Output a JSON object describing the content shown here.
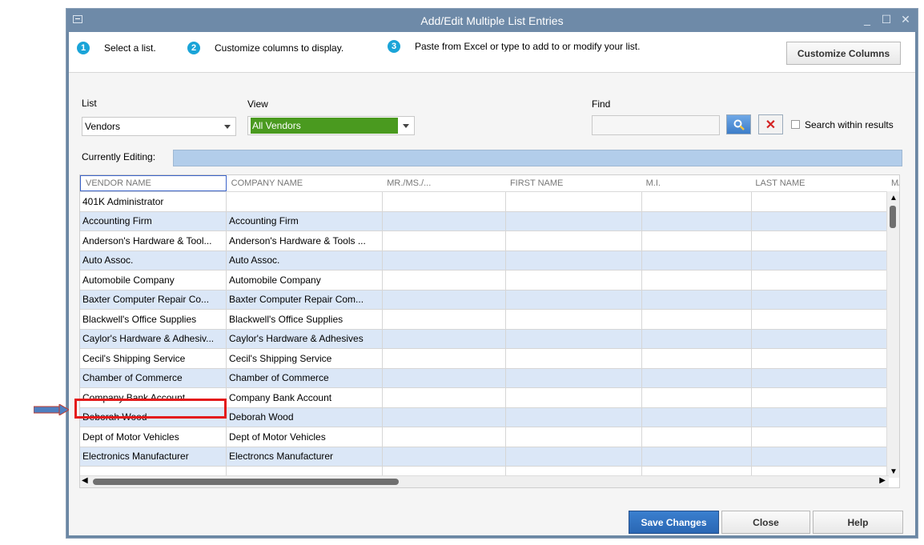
{
  "window": {
    "title": "Add/Edit Multiple List Entries"
  },
  "steps": [
    {
      "num": "1",
      "text": "Select a list."
    },
    {
      "num": "2",
      "text": "Customize columns to display."
    },
    {
      "num": "3",
      "text": "Paste from Excel or type to add to or modify your list."
    }
  ],
  "customize_button": "Customize Columns",
  "list": {
    "label": "List",
    "value": "Vendors"
  },
  "view": {
    "label": "View",
    "value": "All Vendors"
  },
  "find": {
    "label": "Find",
    "value": "",
    "search_within": "Search within results"
  },
  "currently_editing": {
    "label": "Currently Editing:",
    "value": ""
  },
  "columns": [
    "VENDOR NAME",
    "COMPANY NAME",
    "MR./MS./...",
    "FIRST NAME",
    "M.I.",
    "LAST NAME",
    "M/"
  ],
  "rows": [
    [
      "401K Administrator",
      ""
    ],
    [
      "Accounting Firm",
      "Accounting Firm"
    ],
    [
      "Anderson's Hardware & Tool...",
      "Anderson's Hardware & Tools ..."
    ],
    [
      "Auto Assoc.",
      "Auto Assoc."
    ],
    [
      "Automobile Company",
      "Automobile Company"
    ],
    [
      "Baxter Computer Repair Co...",
      "Baxter Computer Repair Com..."
    ],
    [
      "Blackwell's Office Supplies",
      "Blackwell's Office Supplies"
    ],
    [
      "Caylor's Hardware & Adhesiv...",
      "Caylor's Hardware & Adhesives"
    ],
    [
      "Cecil's Shipping Service",
      "Cecil's Shipping Service"
    ],
    [
      "Chamber of Commerce",
      "Chamber of Commerce"
    ],
    [
      "Company Bank Account",
      "Company Bank Account"
    ],
    [
      "Deborah Wood",
      "Deborah Wood"
    ],
    [
      "Dept of Motor Vehicles",
      "Dept of Motor Vehicles"
    ],
    [
      "Electronics Manufacturer",
      "Electroncs Manufacturer"
    ],
    [
      "",
      ""
    ]
  ],
  "buttons": {
    "save": "Save Changes",
    "close": "Close",
    "help": "Help"
  },
  "colors": {
    "titlebar": "#6e8aa8",
    "view_selected": "#4a9a1f",
    "highlight": "#e41b1b",
    "row_alt": "#dbe7f7"
  },
  "annotation": {
    "highlighted_row": "Deborah Wood"
  }
}
